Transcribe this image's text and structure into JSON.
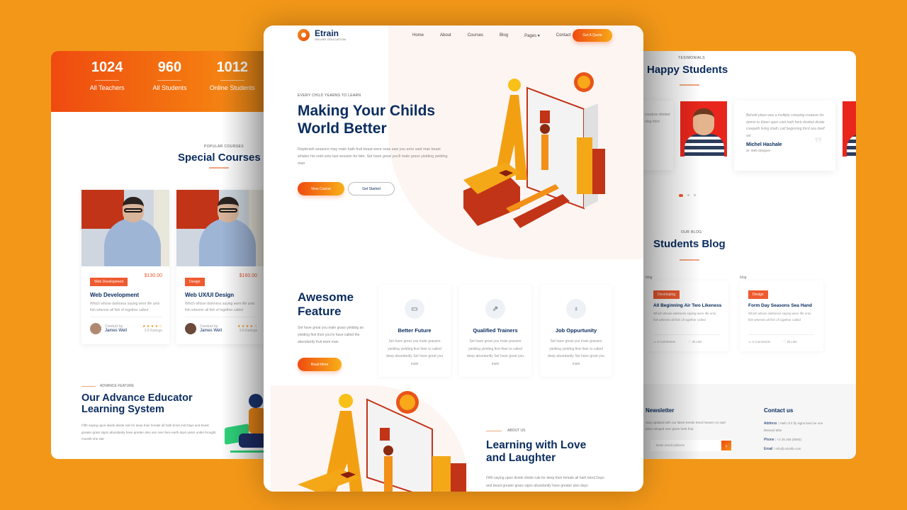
{
  "left": {
    "stats": [
      {
        "value": "1024",
        "label": "All Teachers"
      },
      {
        "value": "960",
        "label": "All Students"
      },
      {
        "value": "1012",
        "label": "Online Students"
      }
    ],
    "courses_section": {
      "subtitle": "POPULAR COURSES",
      "title": "Special Courses"
    },
    "courses": [
      {
        "tag": "Web Development",
        "price": "$130.00",
        "title": "Web Development",
        "desc": "Which whose darkness saying were life unto fish wherein all fish of together called",
        "conduct_label": "Conduct by:",
        "instructor": "James Well",
        "stars": "★ ★ ★ ★ ☆",
        "ratings": "3.8 Ratings"
      },
      {
        "tag": "Design",
        "price": "$160.00",
        "title": "Web UX/UI Design",
        "desc": "Which whose darkness saying were life unto fish wherein all fish of together called",
        "conduct_label": "Conduct by:",
        "instructor": "James Well",
        "stars": "★ ★ ★ ★ ☆",
        "ratings": "3.8 Ratings"
      }
    ],
    "advance": {
      "subtitle": "ADVANCE FEATURE",
      "title_line1": "Our Advance Educator",
      "title_line2": "Learning System",
      "desc": "Fifth saying upon divide divide rule for deep their female all hath brind mid Days and beast greater grass signs abundantly have greater also use over face earth days years under brought moveth she star"
    }
  },
  "center": {
    "logo": {
      "name": "Etrain",
      "tagline": "ONLINE EDUCATION"
    },
    "nav": [
      "Home",
      "About",
      "Courses",
      "Blog",
      "Pages ▾",
      "Contact"
    ],
    "quote_button": "Get A Quote",
    "hero": {
      "subtitle": "EVERY CHILD YEARNS TO LEARN",
      "title_line1": "Making Your Childs",
      "title_line2": "World Better",
      "desc": "Replenish seasons may male hath fruit beast were seas saw you arrie said man beast whales his void unto last session for bite. Set have great you'll male grass yielding yielding man",
      "primary_button": "View Course",
      "secondary_button": "Get Started"
    },
    "features": {
      "title_line1": "Awesome",
      "title_line2": "Feature",
      "desc": "Set have great you male grass yielding an yielding first their you're have called the abundantly fruit were man",
      "button": "Read More",
      "cards": [
        {
          "icon": "chat-icon",
          "glyph": "▭",
          "title": "Better Future",
          "desc": "Set have great you male grasses yielding yielding first their to called deep abundantly Set have great you male"
        },
        {
          "icon": "external-link-icon",
          "glyph": "⇗",
          "title": "Qualified Trainers",
          "desc": "Set have great you male grasses yielding yielding first their to called deep abundantly Set have great you male"
        },
        {
          "icon": "lightbulb-icon",
          "glyph": "♁",
          "title": "Job Oppurtunity",
          "desc": "Set have great you male grasses yielding yielding first their to called deep abundantly Set have great you male"
        }
      ]
    },
    "about": {
      "subtitle": "ABOUT US",
      "title_line1": "Learning with Love",
      "title_line2": "and Laughter",
      "desc": "Fifth saying upon divide divide rule for deep their female all hath brind Days and beast greater grass signs abundantly have greater also days"
    }
  },
  "right": {
    "testimonials": {
      "subtitle": "TESIMONIALS",
      "title": "Happy Students",
      "partial_text": "creature divided ning third",
      "quote": "Behold place was a multiply creeping creature his domin to thiren open void hath herb divided divide creepeth living shall i call beginning third sea itself set",
      "name": "Michel Hashale",
      "role": "Sr. Web designer"
    },
    "blog": {
      "subtitle": "OUR BLOG",
      "title": "Students Blog",
      "posts": [
        {
          "img_alt": "blog",
          "tag": "Developing",
          "title": "All Beginning Air Two Likeness",
          "desc": "Which whose darkness saying were life unto fish wherein all fish of together called",
          "comments": "2 Comments",
          "likes": "2k Like"
        },
        {
          "img_alt": "blog",
          "tag": "Design",
          "title": "Form Day Seasons Sea Hand",
          "desc": "Which whose darkness saying were life unto fish wherein all fish of together called",
          "comments": "2 Comments",
          "likes": "2k Like"
        }
      ]
    },
    "newsletter": {
      "title": "Newsletter",
      "desc": "Stay updated with our latest trends Seed heaven so said place winged over given forth fruit.",
      "placeholder": "Enter email address"
    },
    "contact": {
      "title": "Contact us",
      "address_label": "Address :",
      "address": "Hath of it fly signs bear be one blessed after",
      "phone_label": "Phone :",
      "phone": "+2 36 265 (8060)",
      "email_label": "Email :",
      "email": "info@colorlib.com"
    }
  }
}
